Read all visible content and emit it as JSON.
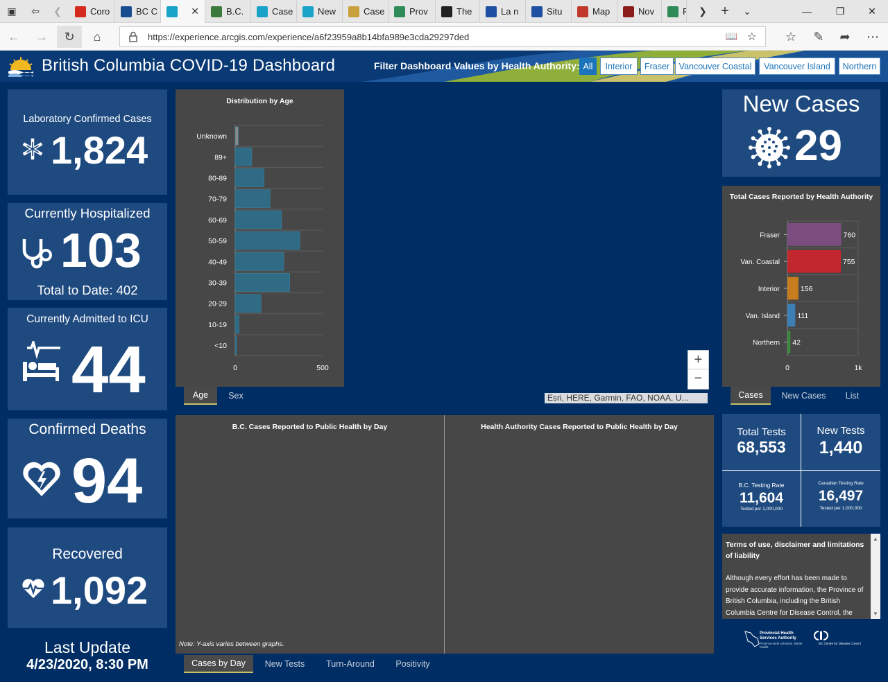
{
  "browser": {
    "tabs": [
      {
        "label": "Coro",
        "favicon": "maple-leaf-icon",
        "color": "#d52b1e"
      },
      {
        "label": "BC C",
        "favicon": "bccdc-icon",
        "color": "#1a4d8f"
      },
      {
        "label": "",
        "favicon": "arcgis-icon",
        "color": "#1aa3c9",
        "active": true
      },
      {
        "label": "B.C.",
        "favicon": "globe-icon",
        "color": "#3c7a3c"
      },
      {
        "label": "Case",
        "favicon": "arcgis-icon",
        "color": "#1aa3c9"
      },
      {
        "label": "New",
        "favicon": "arcgis-icon",
        "color": "#1aa3c9"
      },
      {
        "label": "Case",
        "favicon": "doc-icon",
        "color": "#c9a13c"
      },
      {
        "label": "Prov",
        "favicon": "green-bar-icon",
        "color": "#2e8b57"
      },
      {
        "label": "The",
        "favicon": "circle-icon",
        "color": "#222222"
      },
      {
        "label": "La n",
        "favicon": "quebec-icon",
        "color": "#1f4fa3"
      },
      {
        "label": "Situ",
        "favicon": "quebec-icon",
        "color": "#1f4fa3"
      },
      {
        "label": "Map",
        "favicon": "pdf-icon",
        "color": "#c0392b"
      },
      {
        "label": "Nov",
        "favicon": "image-icon",
        "color": "#8b1a1a"
      },
      {
        "label": "F",
        "favicon": "tree-icon",
        "color": "#2e8b57"
      }
    ],
    "url": "https://experience.arcgis.com/experience/a6f23959a8b14bfa989e3cda29297ded"
  },
  "header": {
    "title": "British Columbia COVID-19 Dashboard",
    "filter_label": "Filter Dashboard Values by Health Authority:",
    "filters": [
      "All",
      "Interior",
      "Fraser",
      "Vancouver Coastal",
      "Vancouver Island",
      "Northern"
    ],
    "selected_filter": "All"
  },
  "stats": {
    "lab_confirmed": {
      "label": "Laboratory Confirmed Cases",
      "value": "1,824"
    },
    "hospitalized": {
      "label": "Currently Hospitalized",
      "value": "103",
      "sub": "Total to Date: 402"
    },
    "icu": {
      "label": "Currently Admitted to ICU",
      "value": "44"
    },
    "deaths": {
      "label": "Confirmed Deaths",
      "value": "94"
    },
    "recovered": {
      "label": "Recovered",
      "value": "1,092"
    },
    "last_update": {
      "label": "Last Update",
      "value": "4/23/2020, 8:30 PM"
    }
  },
  "new_cases": {
    "label": "New Cases",
    "value": "29"
  },
  "age_chart": {
    "title": "Distribution by Age",
    "tabs": [
      "Age",
      "Sex"
    ],
    "active_tab": "Age"
  },
  "ha_chart": {
    "title": "Total Cases Reported by Health Authority",
    "tabs": [
      "Cases",
      "New Cases",
      "List"
    ],
    "active_tab": "Cases"
  },
  "daily_panels": {
    "bc_title": "B.C. Cases Reported to Public Health by Day",
    "ha_title": "Health Authority Cases Reported to Public Health by Day",
    "note": "Note: Y-axis varies between graphs.",
    "tabs": [
      "Cases by Day",
      "New Tests",
      "Turn-Around",
      "Positivity"
    ],
    "active_tab": "Cases by Day"
  },
  "map": {
    "attribution": "Esri, HERE, Garmin, FAO, NOAA, U...",
    "zoom_in": "+",
    "zoom_out": "−"
  },
  "testing": {
    "total_tests": {
      "label": "Total Tests",
      "value": "68,553"
    },
    "new_tests": {
      "label": "New Tests",
      "value": "1,440"
    },
    "bc_rate": {
      "label": "B.C. Testing Rate",
      "value": "11,604",
      "sub": "Tested per 1,000,000"
    },
    "canada_rate": {
      "label": "Canadian Testing Rate",
      "value": "16,497",
      "sub": "Tested per 1,000,000"
    }
  },
  "terms": {
    "title": "Terms of use, disclaimer and limitations of liability",
    "body": "Although every effort has been made to provide accurate information, the Province of British Columbia, including the British Columbia Centre for Disease Control, the"
  },
  "footer_logos": {
    "phsa": "Provincial Health Services Authority",
    "phsa_tag": "Province-wide solutions. Better health.",
    "bccdc": "BC Centre for Disease Control"
  },
  "colors": {
    "dash_bg": "#002e64",
    "panel_bg": "#1e4a80",
    "chart_bg": "#474747",
    "age_bar": "#2f6b84",
    "ha_fraser": "#7b4d7e",
    "ha_vancoastal": "#c1272d",
    "ha_interior": "#c77c1e",
    "ha_vanisland": "#3c7fb6",
    "ha_northern": "#3d8a3d"
  },
  "chart_data": [
    {
      "type": "bar",
      "orientation": "horizontal",
      "title": "Distribution by Age",
      "categories": [
        "Unknown",
        "89+",
        "80-89",
        "70-79",
        "60-69",
        "50-59",
        "40-49",
        "30-39",
        "20-29",
        "10-19",
        "<10"
      ],
      "values": [
        18,
        95,
        165,
        200,
        265,
        370,
        278,
        312,
        148,
        22,
        8
      ],
      "xlim": [
        0,
        500
      ],
      "xticks": [
        "0",
        "500"
      ],
      "grid": true
    },
    {
      "type": "bar",
      "orientation": "horizontal",
      "title": "Total Cases Reported by Health Authority",
      "categories": [
        "Fraser",
        "Van. Coastal",
        "Interior",
        "Van. Island",
        "Northern"
      ],
      "values": [
        760,
        755,
        156,
        111,
        42
      ],
      "labels": [
        "760",
        "755",
        "156",
        "111",
        "42"
      ],
      "xlim": [
        0,
        1000
      ],
      "xticks": [
        "0",
        "1k"
      ],
      "grid": true
    }
  ]
}
